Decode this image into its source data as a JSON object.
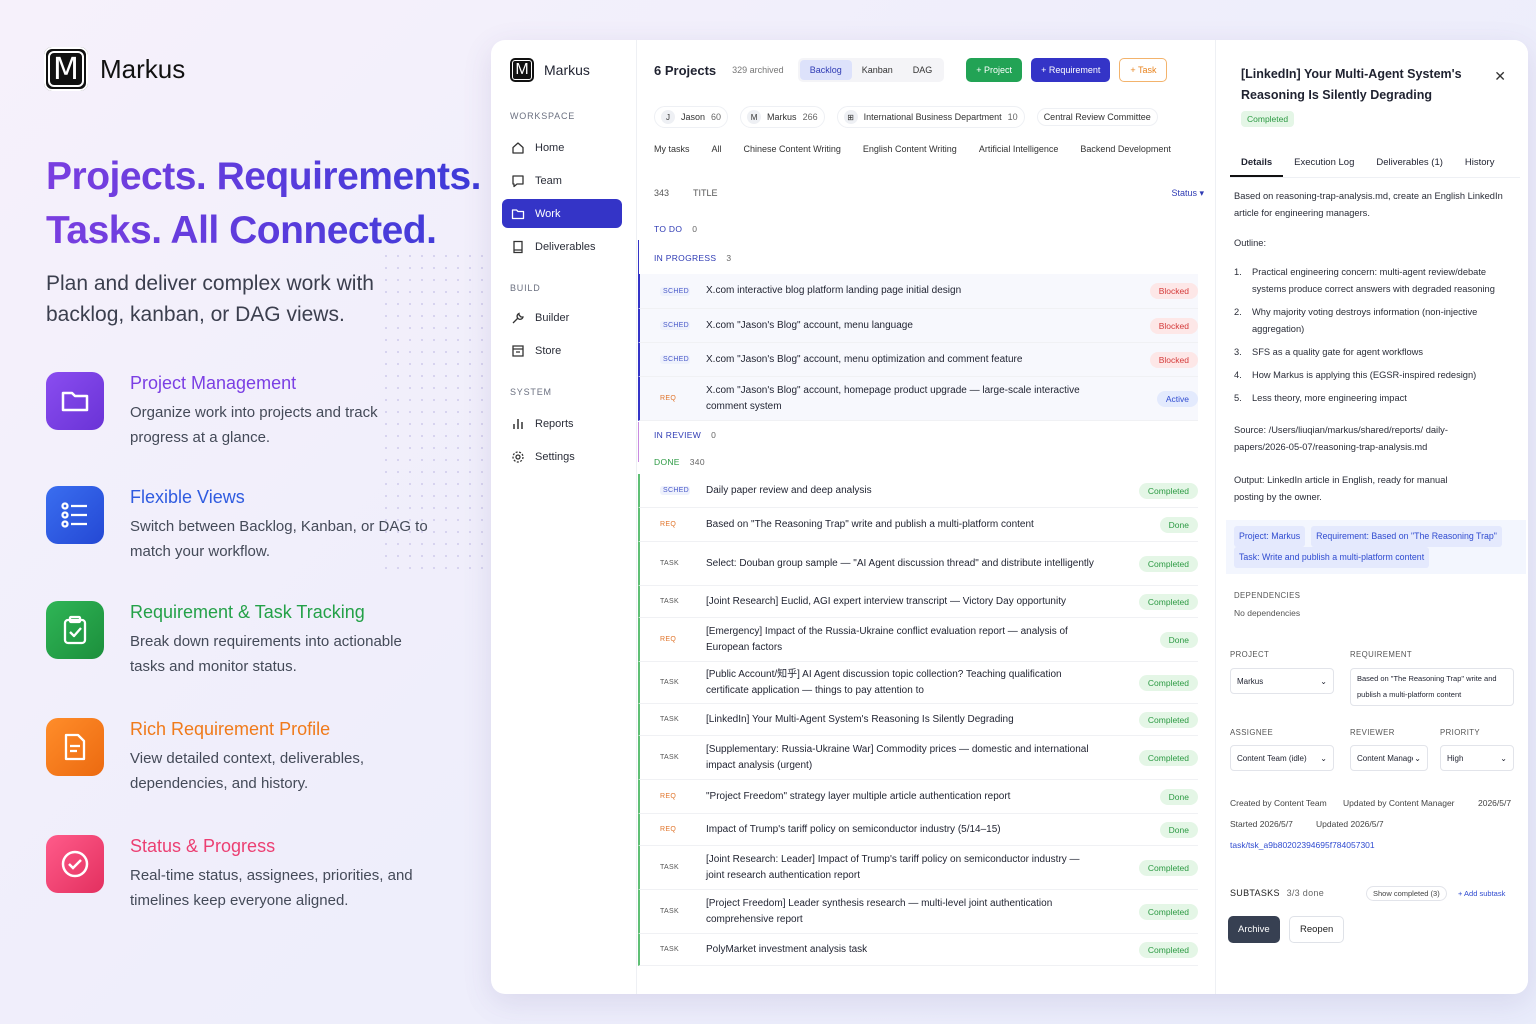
{
  "brand": {
    "name": "Markus",
    "logo": "M"
  },
  "hero": {
    "line1": "Projects. Requirements.",
    "line2": "Tasks. All Connected.",
    "subtitle": "Plan and deliver complex work with backlog, kanban, or DAG views."
  },
  "features": [
    {
      "title": "Project Management",
      "desc": "Organize work into projects and track progress at a glance.",
      "color": "#7b3fe4",
      "icon": "folder-icon"
    },
    {
      "title": "Flexible Views",
      "desc": "Switch between Backlog, Kanban, or DAG to match your workflow.",
      "color": "#2f5be0",
      "icon": "list-icon"
    },
    {
      "title": "Requirement & Task Tracking",
      "desc": "Break down requirements into actionable tasks and monitor status.",
      "color": "#24a148",
      "icon": "clipboard-check-icon"
    },
    {
      "title": "Rich Requirement Profile",
      "desc": "View detailed context, deliverables, dependencies, and history.",
      "color": "#f07a1a",
      "icon": "document-icon"
    },
    {
      "title": "Status & Progress",
      "desc": "Real-time status, assignees, priorities, and timelines keep everyone aligned.",
      "color": "#ec3f72",
      "icon": "check-circle-icon"
    }
  ],
  "sidebar": {
    "app_name": "Markus",
    "sections": {
      "workspace": "WORKSPACE",
      "build": "BUILD",
      "system": "SYSTEM"
    },
    "items": [
      {
        "label": "Home",
        "icon": "home-icon"
      },
      {
        "label": "Team",
        "icon": "chat-icon"
      },
      {
        "label": "Work",
        "icon": "folder-icon"
      },
      {
        "label": "Deliverables",
        "icon": "book-icon"
      },
      {
        "label": "Builder",
        "icon": "wrench-icon"
      },
      {
        "label": "Store",
        "icon": "store-icon"
      },
      {
        "label": "Reports",
        "icon": "bar-chart-icon"
      },
      {
        "label": "Settings",
        "icon": "gear-icon"
      }
    ]
  },
  "toolbar": {
    "projects": "6 Projects",
    "archived": "329 archived",
    "views": [
      "Backlog",
      "Kanban",
      "DAG"
    ],
    "project_btn": "+ Project",
    "requirement_btn": "+ Requirement",
    "task_btn": "+ Task"
  },
  "filters": [
    {
      "avatar": "J",
      "name": "Jason",
      "count": "60"
    },
    {
      "avatar": "M",
      "name": "Markus",
      "count": "266"
    },
    {
      "avatar": "⊞",
      "name": "International Business Department",
      "count": "10"
    },
    {
      "avatar": "",
      "name": "Central Review Committee",
      "count": ""
    }
  ],
  "category_tabs": [
    "My tasks",
    "All",
    "Chinese Content Writing",
    "English Content Writing",
    "Artificial Intelligence",
    "Backend Development"
  ],
  "list_header": {
    "count": "343",
    "title": "TITLE",
    "status": "Status ▾"
  },
  "groups": {
    "todo": {
      "label": "TO DO",
      "count": "0"
    },
    "inprogress": {
      "label": "IN PROGRESS",
      "count": "3"
    },
    "inreview": {
      "label": "IN REVIEW",
      "count": "0"
    },
    "done": {
      "label": "DONE",
      "count": "340"
    }
  },
  "inprogress_rows": [
    {
      "tag": "SCHED",
      "title": "X.com interactive blog platform landing page initial design",
      "status": "Blocked"
    },
    {
      "tag": "SCHED",
      "title": "X.com \"Jason's Blog\" account, menu language",
      "status": "Blocked"
    },
    {
      "tag": "SCHED",
      "title": "X.com \"Jason's Blog\" account, menu optimization and comment feature",
      "status": "Blocked"
    },
    {
      "tag": "REQ",
      "title": "X.com \"Jason's Blog\" account, homepage product upgrade — large-scale interactive comment system",
      "status": "Active"
    }
  ],
  "done_rows": [
    {
      "tag": "SCHED",
      "title": "Daily paper review and deep analysis",
      "status": "Completed"
    },
    {
      "tag": "REQ",
      "title": "Based on \"The Reasoning Trap\" write and publish a multi-platform content",
      "status": "Done"
    },
    {
      "tag": "TASK",
      "title": "Select: Douban group sample — \"AI Agent discussion thread\" and distribute intelligently",
      "status": "Completed"
    },
    {
      "tag": "TASK",
      "title": "[Joint Research] Euclid, AGI expert interview transcript — Victory Day opportunity",
      "status": "Completed"
    },
    {
      "tag": "REQ",
      "title": "[Emergency] Impact of the Russia-Ukraine conflict evaluation report — analysis of European factors",
      "status": "Done"
    },
    {
      "tag": "TASK",
      "title": "[Public Account/知乎] AI Agent discussion topic collection? Teaching qualification certificate application — things to pay attention to",
      "status": "Completed"
    },
    {
      "tag": "TASK",
      "title": "[LinkedIn]  Your Multi-Agent System's Reasoning Is Silently Degrading",
      "status": "Completed"
    },
    {
      "tag": "TASK",
      "title": "[Supplementary: Russia-Ukraine War] Commodity prices — domestic and international impact analysis (urgent)",
      "status": "Completed"
    },
    {
      "tag": "REQ",
      "title": "\"Project Freedom\" strategy layer multiple article authentication report",
      "status": "Done"
    },
    {
      "tag": "REQ",
      "title": "Impact of Trump's tariff policy on semiconductor industry (5/14–15)",
      "status": "Done"
    },
    {
      "tag": "TASK",
      "title": "[Joint Research: Leader] Impact of Trump's tariff policy on semiconductor industry — joint research authentication report",
      "status": "Completed"
    },
    {
      "tag": "TASK",
      "title": "[Project Freedom] Leader synthesis research — multi-level joint authentication comprehensive report",
      "status": "Completed"
    },
    {
      "tag": "TASK",
      "title": "PolyMarket investment analysis task",
      "status": "Completed"
    }
  ],
  "detail": {
    "title": "[LinkedIn]  Your Multi-Agent System's Reasoning Is Silently Degrading",
    "status": "Completed",
    "tabs": [
      "Details",
      "Execution Log",
      "Deliverables (1)",
      "History"
    ],
    "intro": "Based on reasoning-trap-analysis.md, create an English LinkedIn article for engineering managers.",
    "outline_label": "Outline:",
    "outline": [
      "Practical engineering concern: multi-agent review/debate systems produce correct answers with degraded reasoning",
      "Why majority voting destroys information (non-injective aggregation)",
      "SFS as a quality gate for agent workflows",
      "How Markus is applying this (EGSR-inspired redesign)",
      "Less theory, more engineering impact"
    ],
    "source": "Source: /Users/liuqian/markus/shared/reports/ daily-papers/2026-05-07/reasoning-trap-analysis.md",
    "output": "Output: LinkedIn article in English, ready for manual posting by the owner.",
    "link_project": "Project: Markus",
    "link_requirement": "Requirement: Based on \"The Reasoning Trap\"",
    "link_task": "Task: Write and publish a multi-platform content",
    "dependencies_label": "DEPENDENCIES",
    "dependencies_value": "No dependencies",
    "project_label": "PROJECT",
    "project_value": "Markus",
    "requirement_label": "REQUIREMENT",
    "requirement_value": "Based on \"The Reasoning Trap\" write and publish a multi-platform content",
    "assignee_label": "ASSIGNEE",
    "assignee_value": "Content Team (idle)",
    "reviewer_label": "REVIEWER",
    "reviewer_value": "Content Manager",
    "priority_label": "PRIORITY",
    "priority_value": "High",
    "created": "Created by Content Team",
    "updated_by": "Updated by Content Manager",
    "date1": "2026/5/7",
    "started": "Started 2026/5/7",
    "updated": "Updated 2026/5/7",
    "task_id": "task/tsk_a9b80202394695f784057301",
    "subtasks_label": "SUBTASKS",
    "subtasks_count": "3/3 done",
    "show_completed": "Show completed (3)",
    "add_subtask": "+ Add subtask",
    "archive": "Archive",
    "reopen": "Reopen"
  }
}
